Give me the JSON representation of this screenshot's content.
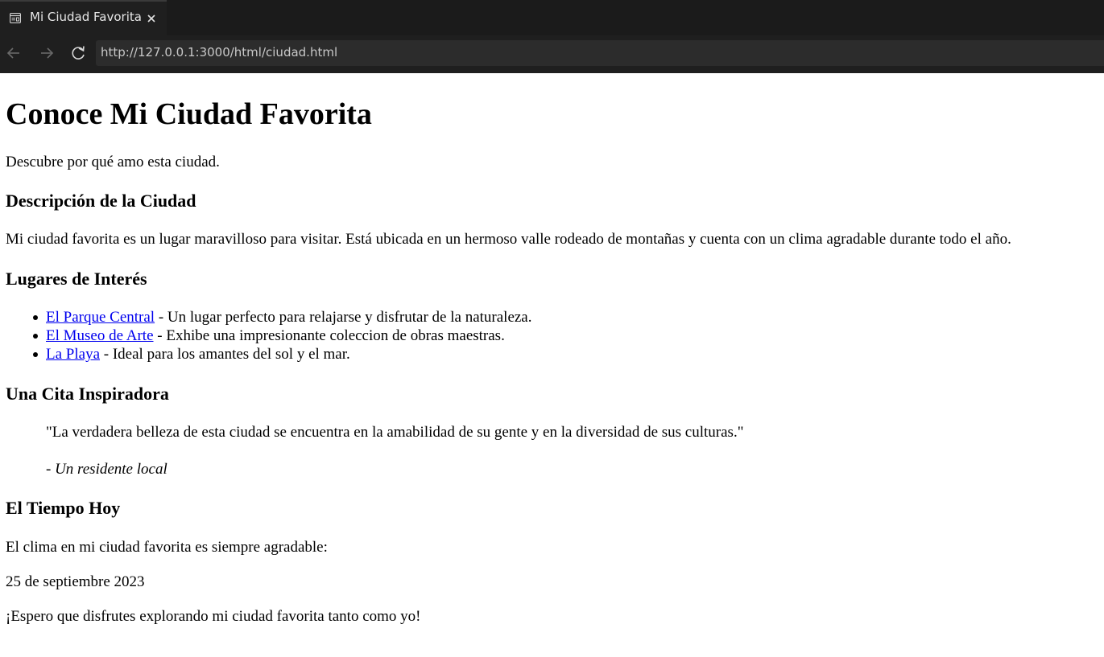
{
  "browser": {
    "tab_title": "Mi Ciudad Favorita",
    "url": "http://127.0.0.1:3000/html/ciudad.html",
    "icons": {
      "tab": "page-icon",
      "close": "close-icon",
      "back": "back-arrow-icon",
      "forward": "forward-arrow-icon",
      "reload": "reload-icon"
    }
  },
  "page": {
    "title": "Conoce Mi Ciudad Favorita",
    "subtitle": "Descubre por qué amo esta ciudad.",
    "description": {
      "heading": "Descripción de la Ciudad",
      "text": "Mi ciudad favorita es un lugar maravilloso para visitar. Está ubicada en un hermoso valle rodeado de montañas y cuenta con un clima agradable durante todo el año."
    },
    "places": {
      "heading": "Lugares de Interés",
      "items": [
        {
          "link": "El Parque Central",
          "text": " - Un lugar perfecto para relajarse y disfrutar de la naturaleza."
        },
        {
          "link": "El Museo de Arte",
          "text": " - Exhibe una impresionante coleccion de obras maestras."
        },
        {
          "link": "La Playa",
          "text": " - Ideal para los amantes del sol y el mar."
        }
      ]
    },
    "quote": {
      "heading": "Una Cita Inspiradora",
      "text": "\"La verdadera belleza de esta ciudad se encuentra en la amabilidad de su gente y en la diversidad de sus culturas.\"",
      "dash": "- ",
      "author": "Un residente local"
    },
    "weather": {
      "heading": "El Tiempo Hoy",
      "intro": "El clima en mi ciudad favorita es siempre agradable:",
      "date": "25 de septiembre 2023"
    },
    "closing": "¡Espero que disfrutes explorando mi ciudad favorita tanto como yo!"
  }
}
